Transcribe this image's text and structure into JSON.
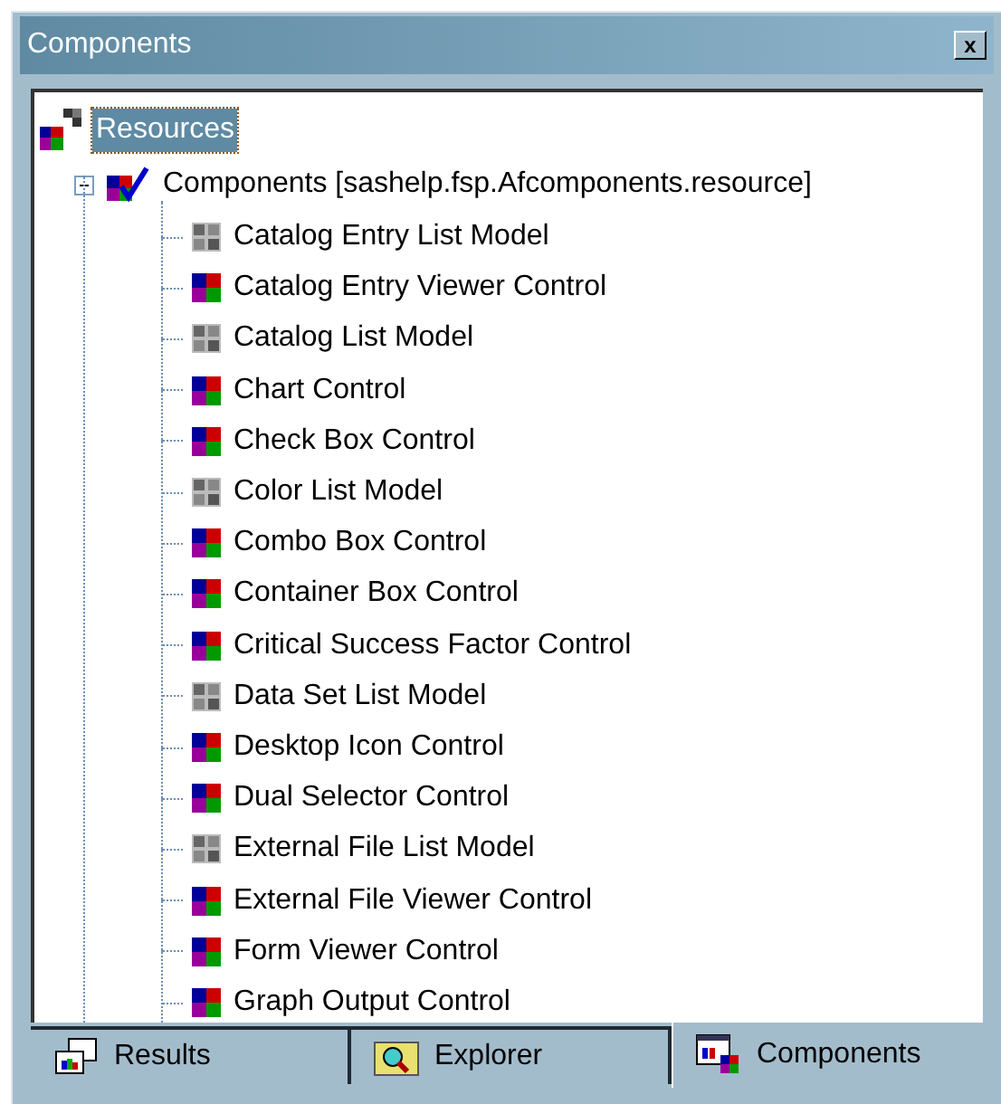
{
  "window": {
    "title": "Components",
    "close": "x"
  },
  "tree": [
    {
      "label": "Resources",
      "selected": true,
      "kind": "root",
      "children": [
        {
          "label": "Components [sashelp.fsp.Afcomponents.resource]",
          "selected": false,
          "kind": "catalog",
          "expanded": true,
          "children": [
            {
              "label": "Catalog Entry List Model",
              "kind": "model",
              "selected": false
            },
            {
              "label": "Catalog Entry Viewer Control",
              "kind": "control",
              "selected": false
            },
            {
              "label": "Catalog List Model",
              "kind": "model",
              "selected": false
            },
            {
              "label": "Chart Control",
              "kind": "control",
              "selected": false
            },
            {
              "label": "Check Box Control",
              "kind": "control",
              "selected": false
            },
            {
              "label": "Color List Model",
              "kind": "model",
              "selected": false
            },
            {
              "label": "Combo Box Control",
              "kind": "control",
              "selected": false
            },
            {
              "label": "Container Box Control",
              "kind": "control",
              "selected": false
            },
            {
              "label": "Critical Success Factor Control",
              "kind": "control",
              "selected": false
            },
            {
              "label": "Data Set List Model",
              "kind": "model",
              "selected": false
            },
            {
              "label": "Desktop Icon Control",
              "kind": "control",
              "selected": false
            },
            {
              "label": "Dual Selector Control",
              "kind": "control",
              "selected": false
            },
            {
              "label": "External File List Model",
              "kind": "model",
              "selected": false
            },
            {
              "label": "External File Viewer Control",
              "kind": "control",
              "selected": false
            },
            {
              "label": "Form Viewer Control",
              "kind": "control",
              "selected": false
            },
            {
              "label": "Graph Output Control",
              "kind": "control",
              "selected": false
            }
          ]
        }
      ]
    }
  ],
  "tabs": [
    {
      "label": "Results",
      "kind": "results",
      "selected": false
    },
    {
      "label": "Explorer",
      "kind": "explorer",
      "selected": false
    },
    {
      "label": "Components",
      "kind": "components",
      "selected": true
    }
  ]
}
